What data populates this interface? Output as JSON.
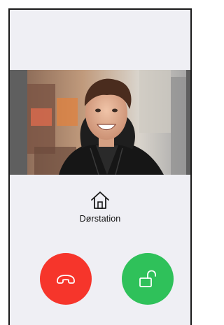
{
  "station": {
    "label": "Dørstation",
    "icon": "home-icon"
  },
  "video": {
    "subject": "caller-face",
    "letterbox_color": "#5f5f5f"
  },
  "actions": {
    "hangup": {
      "icon": "phone-hangup-icon",
      "color": "#f6352b"
    },
    "unlock": {
      "icon": "unlock-icon",
      "color": "#2fc15a"
    }
  },
  "colors": {
    "background": "#efeff4",
    "frame": "#1a1a1a"
  }
}
